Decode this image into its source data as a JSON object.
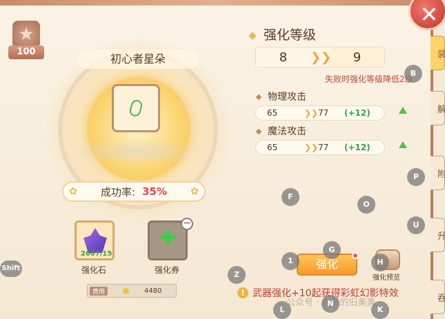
{
  "level_badge": "100",
  "item_name": "初心者星朵",
  "success_rate": {
    "label": "成功率:",
    "value": "35%"
  },
  "materials": {
    "stone": {
      "count": "2667/15",
      "label": "强化石"
    },
    "coupon": {
      "label": "强化券"
    }
  },
  "cost": {
    "tag": "费用",
    "amount": "4480"
  },
  "enhance_level": {
    "title": "强化等级",
    "from": "8",
    "to": "9",
    "fail_note": "失败时强化等级降低2级"
  },
  "stats": [
    {
      "name": "物理攻击",
      "from": "65",
      "to": "77",
      "delta": "(+12)"
    },
    {
      "name": "魔法攻击",
      "from": "65",
      "to": "77",
      "delta": "(+12)"
    }
  ],
  "buttons": {
    "enhance": "强化",
    "preview": "强化预览"
  },
  "notice": "武器强化+10起获得彩虹幻影特效",
  "watermark": "公众号 · 永恒的旧美美",
  "side_tabs": [
    "装",
    "解",
    "附",
    "升",
    "吞"
  ],
  "hotkeys": [
    "B",
    "P",
    "F",
    "O",
    "U",
    "G",
    "1",
    "H",
    "Z",
    "L",
    "N",
    "K",
    "Shift"
  ],
  "colors": {
    "accent": "#f59a2a",
    "danger": "#c43a2f",
    "positive": "#3aa04a"
  }
}
